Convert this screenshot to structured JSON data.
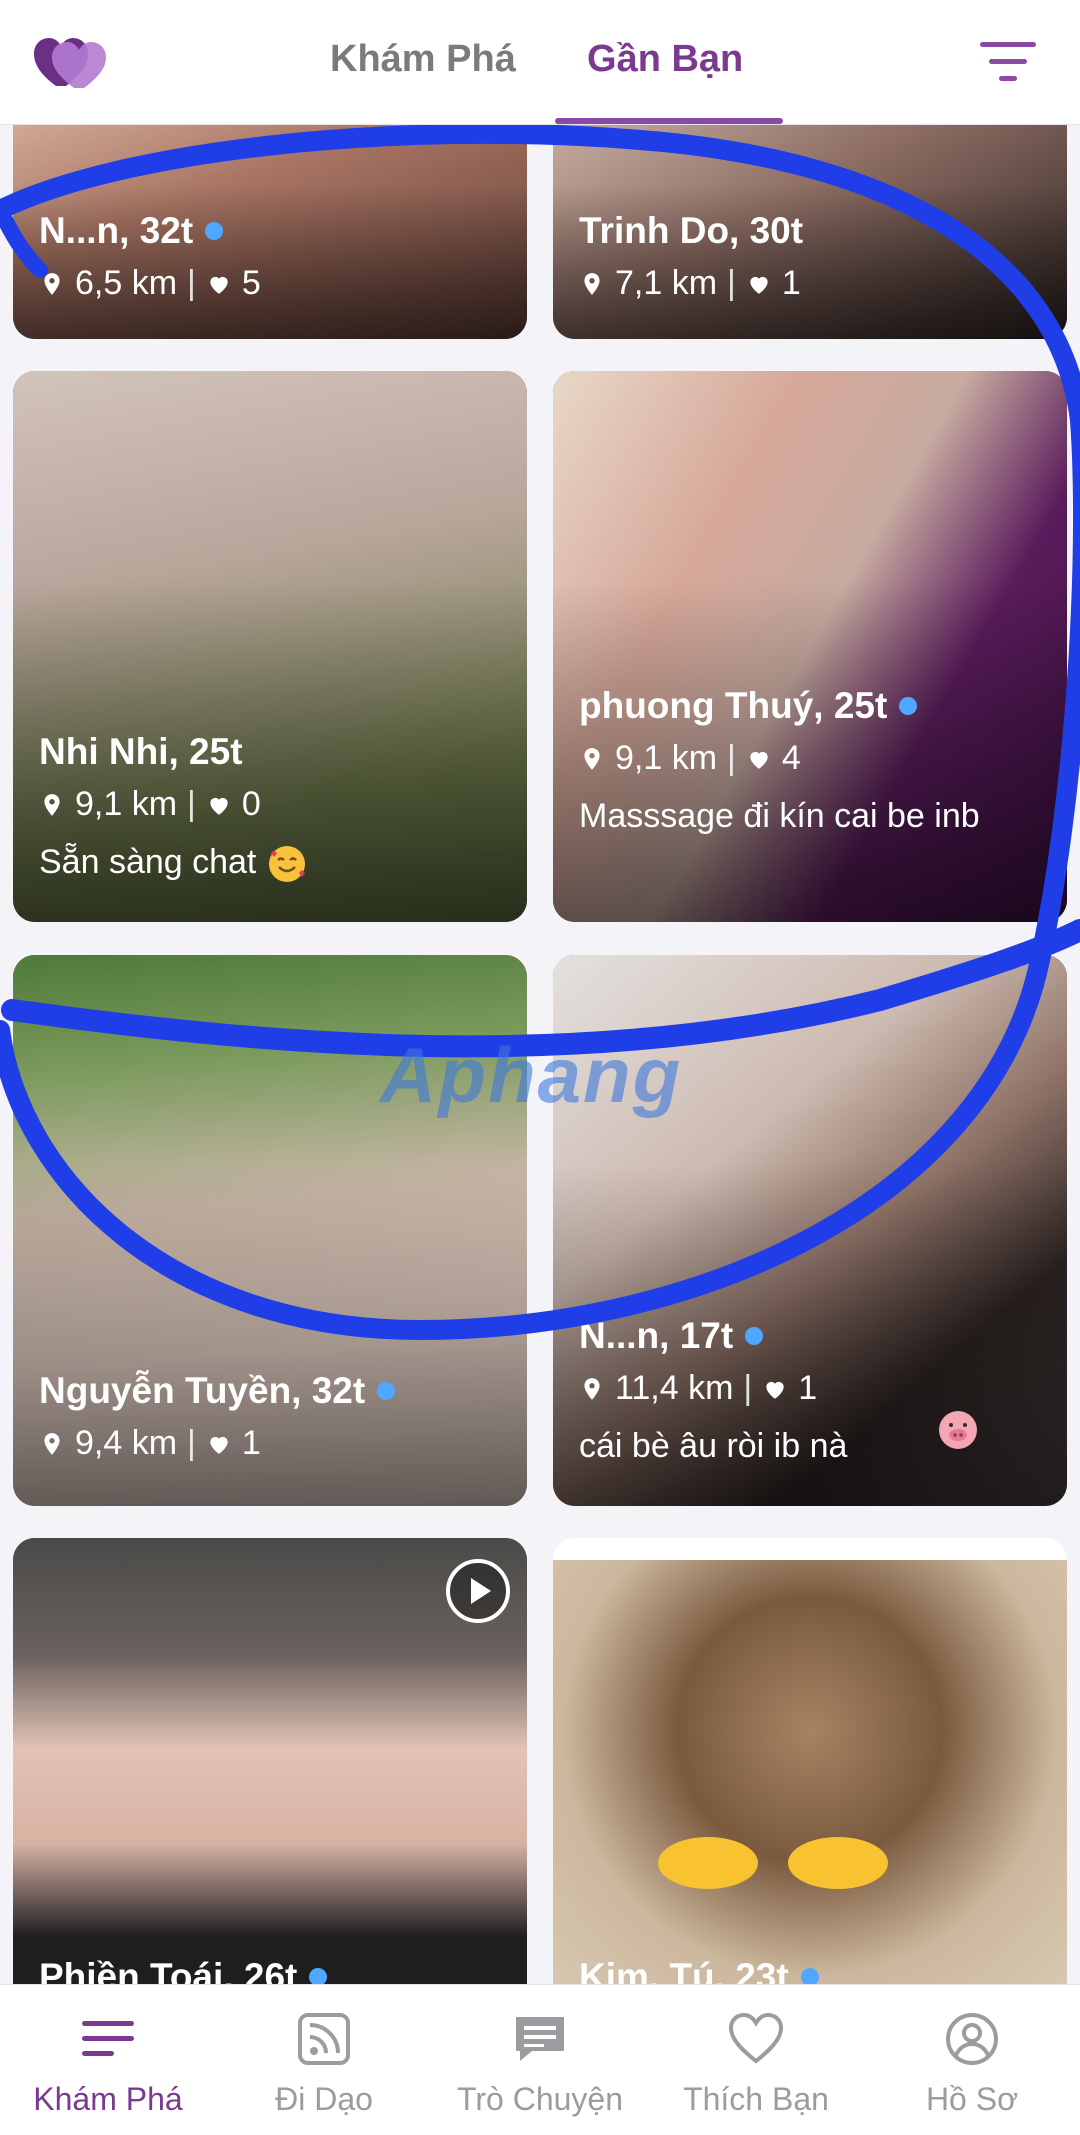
{
  "header": {
    "tabs": [
      {
        "label": "Khám Phá",
        "active": false
      },
      {
        "label": "Gần Bạn",
        "active": true
      }
    ],
    "accent_color": "#7b3a8f"
  },
  "cards": [
    {
      "name": "N...n, 32t",
      "online": true,
      "distance": "6,5 km",
      "likes": "5"
    },
    {
      "name": "Trinh Do, 30t",
      "online": false,
      "distance": "7,1 km",
      "likes": "1"
    },
    {
      "name": "Nhi Nhi, 25t",
      "online": false,
      "distance": "9,1 km",
      "likes": "0",
      "bio": "Sẵn sàng chat"
    },
    {
      "name": "phuong Thuý, 25t",
      "online": true,
      "distance": "9,1 km",
      "likes": "4",
      "bio": "Masssage đi kín cai be inb"
    },
    {
      "name": "Nguyễn Tuyền, 32t",
      "online": true,
      "distance": "9,4 km",
      "likes": "1"
    },
    {
      "name": "N...n, 17t",
      "online": true,
      "distance": "11,4 km",
      "likes": "1",
      "bio": "cái bè âu ròi ib nà"
    },
    {
      "name": "Phiền Toái, 26t",
      "online": true
    },
    {
      "name": "Kim. Tú, 23t",
      "online": true
    }
  ],
  "watermark": "Aphang",
  "bottom_nav": [
    {
      "label": "Khám Phá",
      "icon": "menu-lines-icon",
      "active": true
    },
    {
      "label": "Đi Dạo",
      "icon": "feed-icon",
      "active": false
    },
    {
      "label": "Trò Chuyện",
      "icon": "chat-icon",
      "active": false
    },
    {
      "label": "Thích Bạn",
      "icon": "heart-icon",
      "active": false
    },
    {
      "label": "Hồ Sơ",
      "icon": "profile-icon",
      "active": false
    }
  ]
}
